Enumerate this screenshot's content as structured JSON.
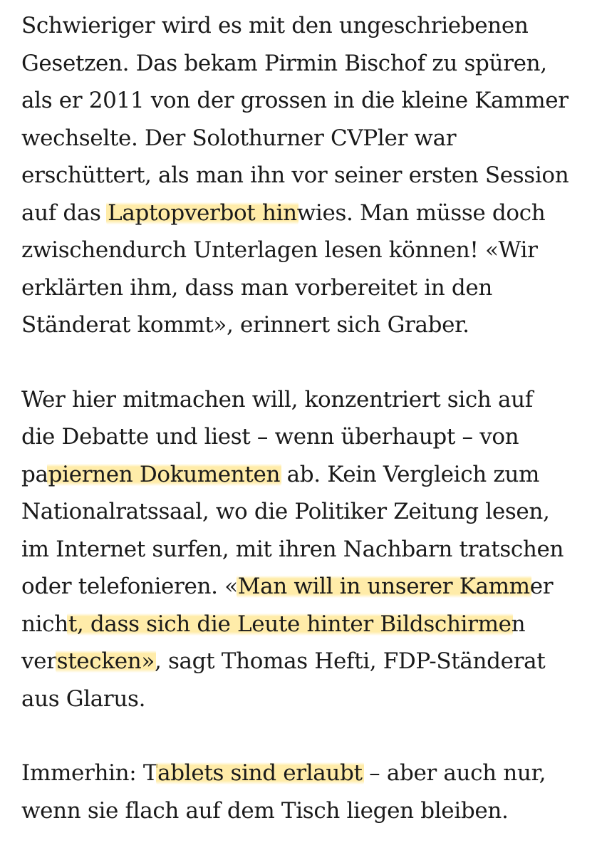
{
  "paragraphs": [
    {
      "lines": [
        [
          {
            "t": "Schwieriger wird es mit den ungeschriebenen",
            "h": false
          }
        ],
        [
          {
            "t": "Gesetzen. Das bekam Pirmin Bischof zu spüren,",
            "h": false
          }
        ],
        [
          {
            "t": "als er 2011 von der grossen in die kleine Kammer",
            "h": false
          }
        ],
        [
          {
            "t": "wechselte. Der Solothurner CVPler war",
            "h": false
          }
        ],
        [
          {
            "t": "erschüttert, als man ihn vor seiner ersten Session",
            "h": false
          }
        ],
        [
          {
            "t": "auf das ",
            "h": false
          },
          {
            "t": "Laptopverbot hin",
            "h": true
          },
          {
            "t": "wies. Man müsse doch",
            "h": false
          }
        ],
        [
          {
            "t": "zwischendurch Unterlagen lesen können! «Wir",
            "h": false
          }
        ],
        [
          {
            "t": "erklärten ihm, dass man vorbereitet in den",
            "h": false
          }
        ],
        [
          {
            "t": "Ständerat kommt», erinnert sich Graber.",
            "h": false
          }
        ]
      ]
    },
    {
      "lines": [
        [
          {
            "t": "Wer hier mitmachen will, konzentriert sich auf",
            "h": false
          }
        ],
        [
          {
            "t": "die Debatte und liest – wenn überhaupt – von",
            "h": false
          }
        ],
        [
          {
            "t": "pa",
            "h": false
          },
          {
            "t": "piernen Dokumenten",
            "h": true
          },
          {
            "t": " ab. Kein Vergleich zum",
            "h": false
          }
        ],
        [
          {
            "t": "Nationalratssaal, wo die Politiker Zeitung lesen,",
            "h": false
          }
        ],
        [
          {
            "t": "im Internet surfen, mit ihren Nachbarn tratschen",
            "h": false
          }
        ],
        [
          {
            "t": "oder telefonieren. «",
            "h": false
          },
          {
            "t": "Man will in unserer Kamm",
            "h": true
          },
          {
            "t": "er",
            "h": false
          }
        ],
        [
          {
            "t": "nich",
            "h": false
          },
          {
            "t": "t, dass sich die Leute hinter Bildschirme",
            "h": true
          },
          {
            "t": "n",
            "h": false
          }
        ],
        [
          {
            "t": "ver",
            "h": false
          },
          {
            "t": "stecken»",
            "h": true
          },
          {
            "t": ", sagt Thomas Hefti, FDP-Ständerat",
            "h": false
          }
        ],
        [
          {
            "t": "aus Glarus.",
            "h": false
          }
        ]
      ]
    },
    {
      "lines": [
        [
          {
            "t": "Immerhin: T",
            "h": false
          },
          {
            "t": "ablets sind erlaubt",
            "h": true
          },
          {
            "t": " – aber auch nur,",
            "h": false
          }
        ],
        [
          {
            "t": "wenn sie flach auf dem Tisch liegen bleiben.",
            "h": false
          }
        ]
      ]
    }
  ],
  "highlight_color": "#ffe68c",
  "text_color": "#1a1a1a"
}
